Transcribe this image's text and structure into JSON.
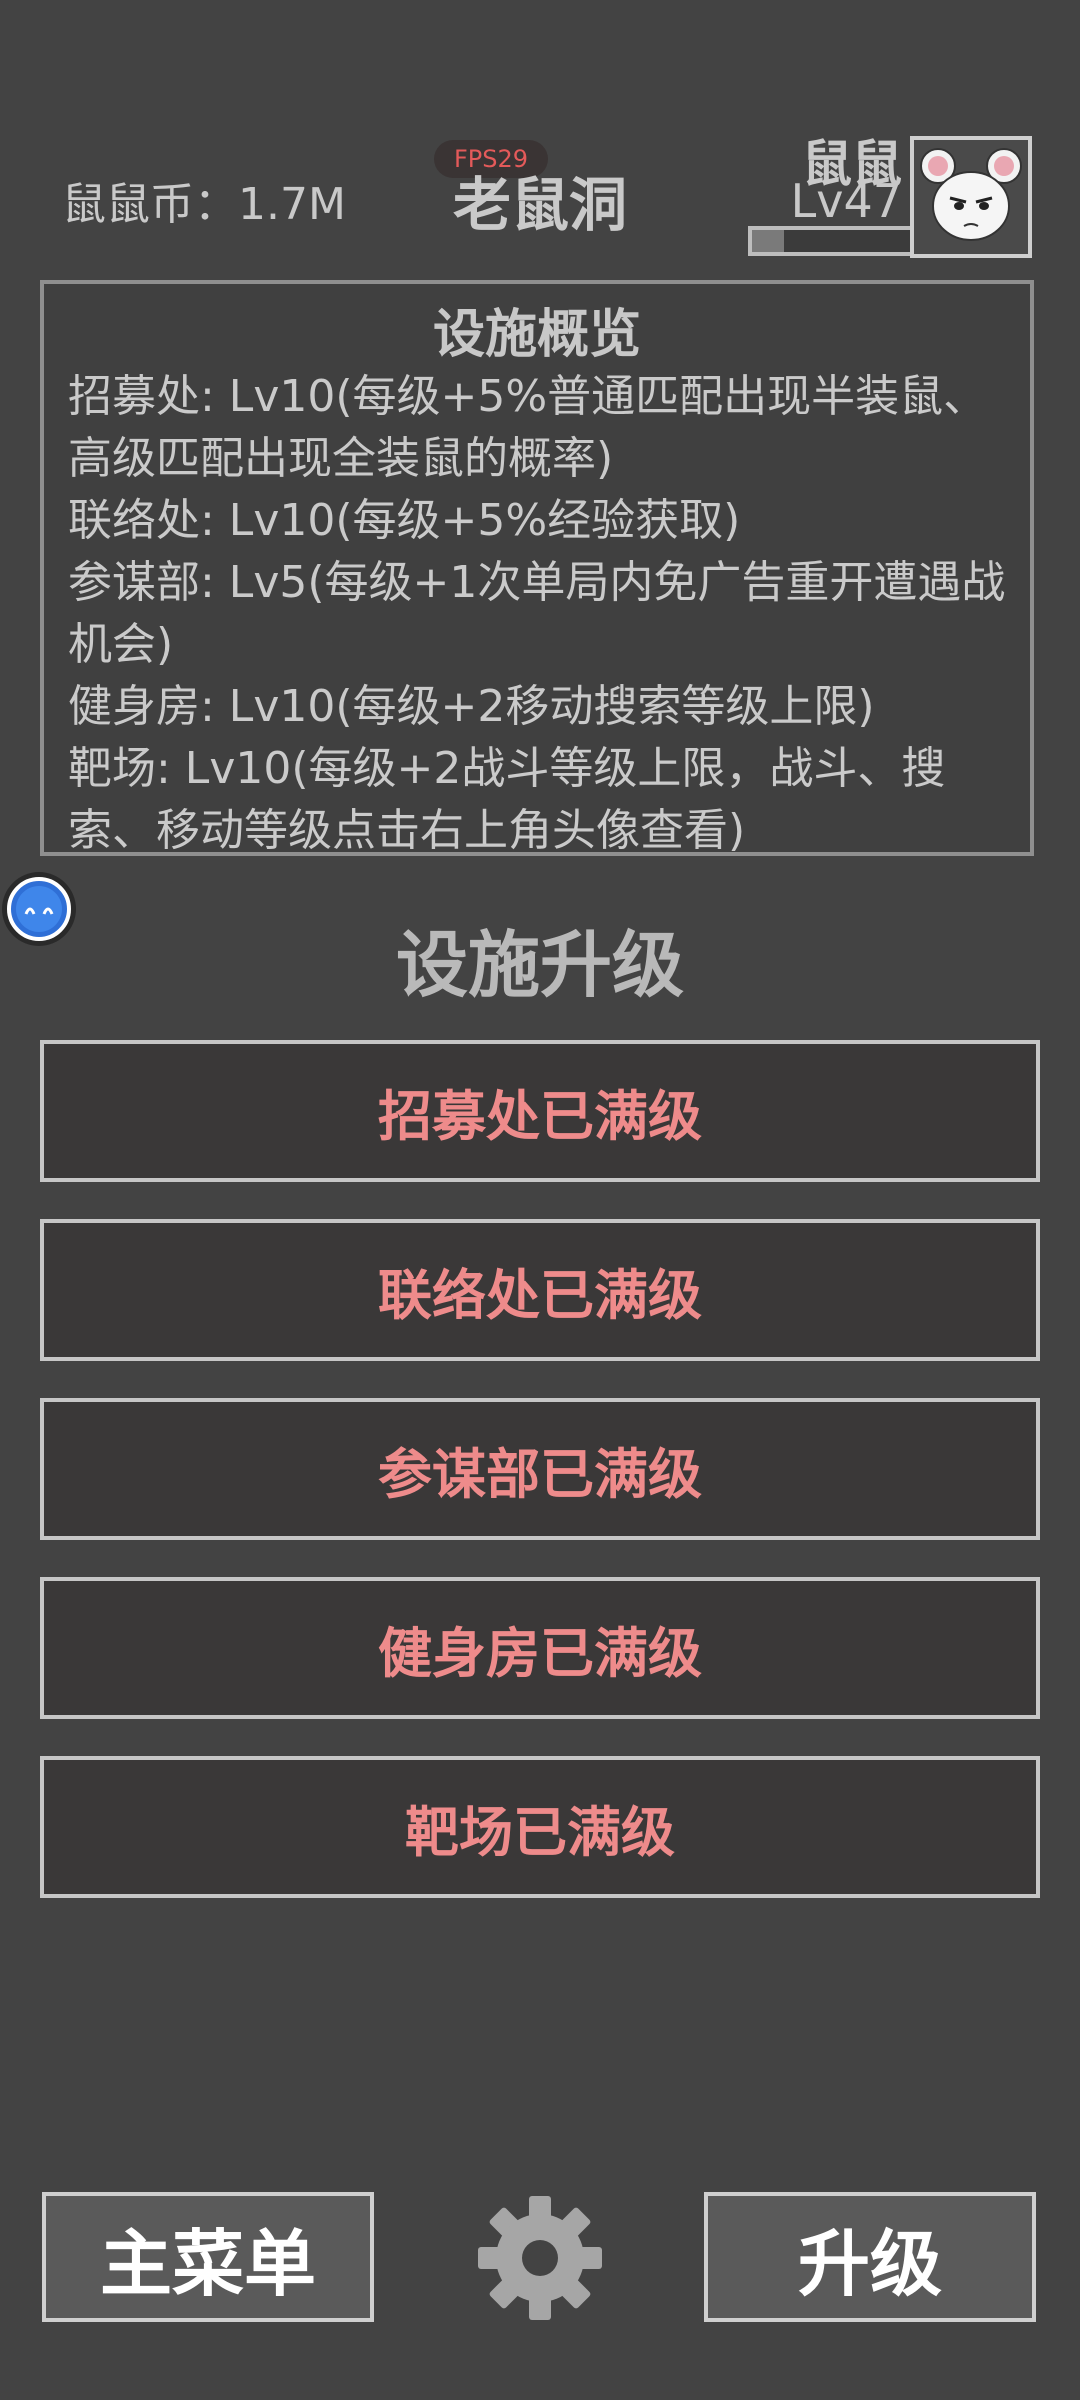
{
  "header": {
    "coin_label": "鼠鼠币：1.7M",
    "fps": "FPS29",
    "title": "老鼠洞",
    "player_name": "鼠鼠",
    "player_level": "Lv47",
    "exp_fraction": 0.2
  },
  "overview": {
    "title": "设施概览",
    "items": [
      "招募处: Lv10(每级+5%普通匹配出现半装鼠、高级匹配出现全装鼠的概率)",
      "联络处: Lv10(每级+5%经验获取)",
      "参谋部: Lv5(每级+1次单局内免广告重开遭遇战机会)",
      "健身房: Lv10(每级+2移动搜索等级上限)",
      "靶场: Lv10(每级+2战斗等级上限，战斗、搜索、移动等级点击右上角头像查看)"
    ]
  },
  "upgrade": {
    "title": "设施升级",
    "buttons": [
      "招募处已满级",
      "联络处已满级",
      "参谋部已满级",
      "健身房已满级",
      "靶场已满级"
    ]
  },
  "bottom": {
    "main_menu": "主菜单",
    "upgrade": "升级"
  },
  "colors": {
    "background": "#434343",
    "maxed_text": "#ee8b8b",
    "fps_text": "#e45a5a"
  },
  "icons": {
    "settings": "gear-icon",
    "avatar": "mouse-avatar",
    "assistant": "assistant-bubble-icon"
  }
}
